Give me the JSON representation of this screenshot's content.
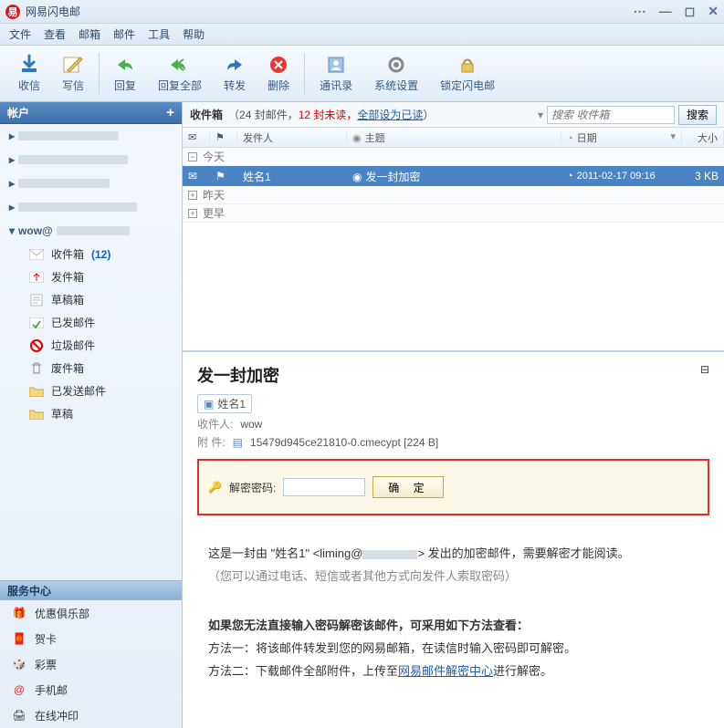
{
  "window": {
    "title": "网易闪电邮"
  },
  "menu": [
    "文件",
    "查看",
    "邮箱",
    "邮件",
    "工具",
    "帮助"
  ],
  "toolbar": {
    "receive": "收信",
    "compose": "写信",
    "reply": "回复",
    "replyall": "回复全部",
    "forward": "转发",
    "delete": "删除",
    "contacts": "通讯录",
    "settings": "系统设置",
    "lock": "锁定闪电邮"
  },
  "account_panel": {
    "title": "帐户",
    "expanded_account": "wow@"
  },
  "folders": [
    {
      "id": "inbox",
      "label": "收件箱",
      "count": "(12)"
    },
    {
      "id": "out",
      "label": "发件箱"
    },
    {
      "id": "draft",
      "label": "草稿箱"
    },
    {
      "id": "unsend",
      "label": "已发邮件"
    },
    {
      "id": "spam",
      "label": "垃圾邮件"
    },
    {
      "id": "trash",
      "label": "废件箱"
    },
    {
      "id": "sent",
      "label": "已发送邮件"
    },
    {
      "id": "drafts2",
      "label": "草稿"
    }
  ],
  "service_center": {
    "title": "服务中心",
    "items": [
      {
        "id": "club",
        "label": "优惠俱乐部"
      },
      {
        "id": "card",
        "label": "贺卡"
      },
      {
        "id": "lotto",
        "label": "彩票"
      },
      {
        "id": "mobile",
        "label": "手机邮"
      },
      {
        "id": "print",
        "label": "在线冲印"
      }
    ]
  },
  "list": {
    "name": "收件箱",
    "summary_open": "（",
    "summary_total": "24 封邮件，",
    "summary_unread": "12 封未读，",
    "mark_all_link": "全部设为已读",
    "summary_close": "）",
    "search_placeholder": "搜索 收件箱",
    "search_btn": "搜索",
    "cols": {
      "from": "发件人",
      "subject": "主题",
      "date": "日期",
      "size": "大小"
    },
    "groups": {
      "today": "今天",
      "yesterday": "昨天",
      "earlier": "更早"
    },
    "row": {
      "from": "姓名1",
      "subject": "发一封加密",
      "date": "2011-02-17 09:16",
      "size": "3 KB"
    }
  },
  "preview": {
    "subject": "发一封加密",
    "sender_card": "姓名1",
    "to_label": "收件人:",
    "to_value": "wow",
    "att_label": "附 件:",
    "att_value": "15479d945ce21810-0.cmecypt [224 B]",
    "decrypt_label": "解密密码:",
    "decrypt_btn": "确 定",
    "body_line1_a": "这是一封由 \"姓名1\" <liming@",
    "body_line1_b": "> 发出的加密邮件，需要解密才能阅读。",
    "body_line2": "（您可以通过电话、短信或者其他方式向发件人索取密码）",
    "body_bold": "如果您无法直接输入密码解密该邮件，可采用如下方法查看：",
    "body_m1": "方法一：将该邮件转发到您的网易邮箱，在读信时输入密码即可解密。",
    "body_m2_a": "方法二：下载邮件全部附件，上传至",
    "body_m2_link": "网易邮件解密中心",
    "body_m2_b": "进行解密。"
  }
}
